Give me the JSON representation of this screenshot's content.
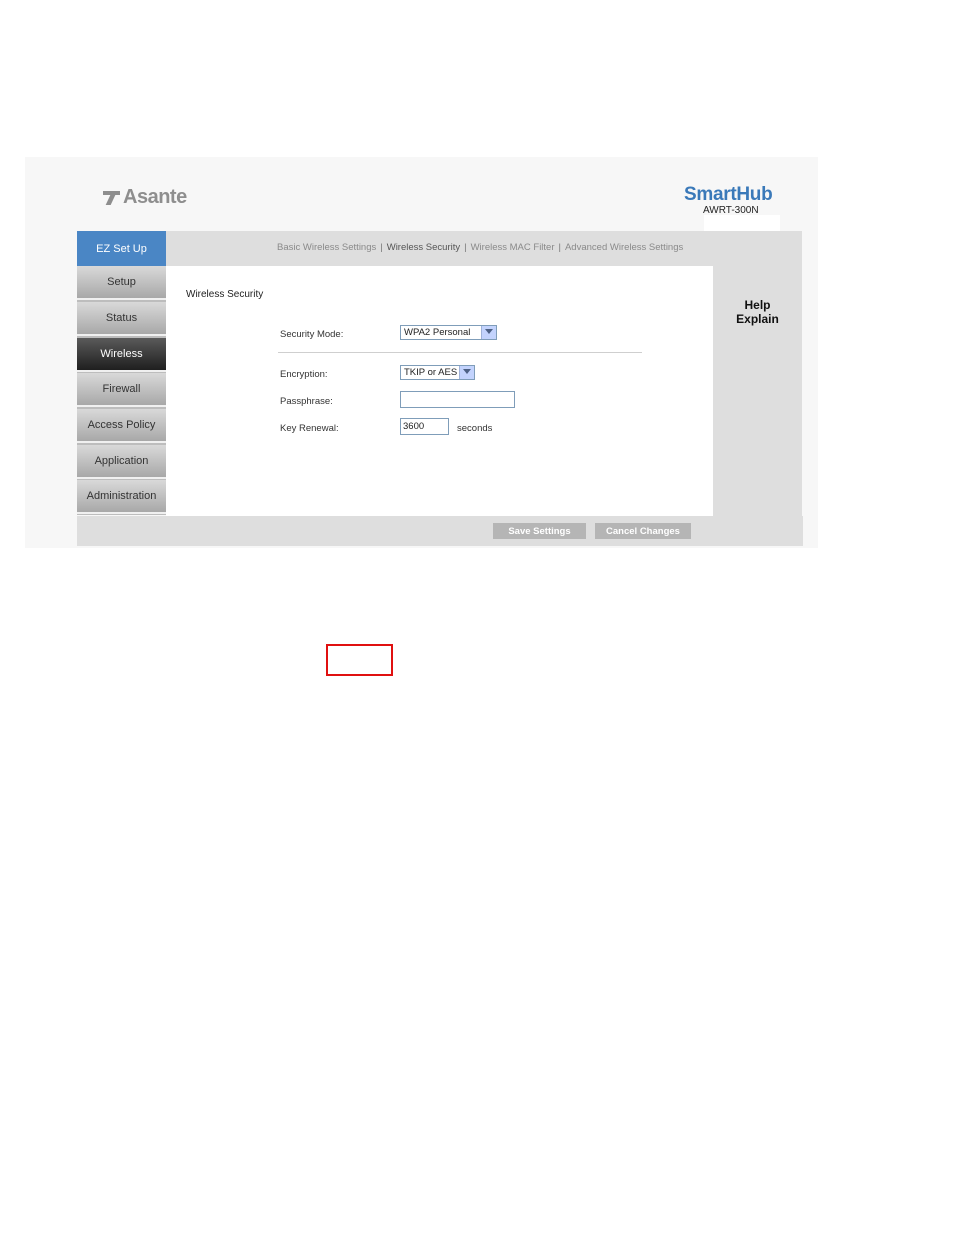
{
  "brand": {
    "logo_text": "Asante",
    "product_name": "SmartHub",
    "model": "AWRT-300N"
  },
  "nav": {
    "items": [
      {
        "label": "EZ Set Up"
      },
      {
        "label": "Setup"
      },
      {
        "label": "Status"
      },
      {
        "label": "Wireless"
      },
      {
        "label": "Firewall"
      },
      {
        "label": "Access Policy"
      },
      {
        "label": "Application"
      },
      {
        "label": "Administration"
      }
    ],
    "active": "Wireless"
  },
  "tabs": {
    "items": [
      {
        "label": "Basic Wireless Settings"
      },
      {
        "label": "Wireless Security"
      },
      {
        "label": "Wireless MAC Filter"
      },
      {
        "label": "Advanced Wireless Settings"
      }
    ],
    "separator": "|",
    "current": "Wireless Security"
  },
  "section": {
    "title": "Wireless Security"
  },
  "form": {
    "security_mode": {
      "label": "Security Mode:",
      "value": "WPA2 Personal"
    },
    "encryption": {
      "label": "Encryption:",
      "value": "TKIP or AES"
    },
    "passphrase": {
      "label": "Passphrase:",
      "value": ""
    },
    "key_renewal": {
      "label": "Key Renewal:",
      "value": "3600",
      "units": "seconds"
    }
  },
  "help": {
    "line1": "Help",
    "line2": "Explain"
  },
  "buttons": {
    "save": "Save Settings",
    "cancel": "Cancel Changes"
  },
  "colors": {
    "accent": "#4a86c5",
    "brand_blue": "#3a79b9",
    "highlight": "#e01010"
  }
}
